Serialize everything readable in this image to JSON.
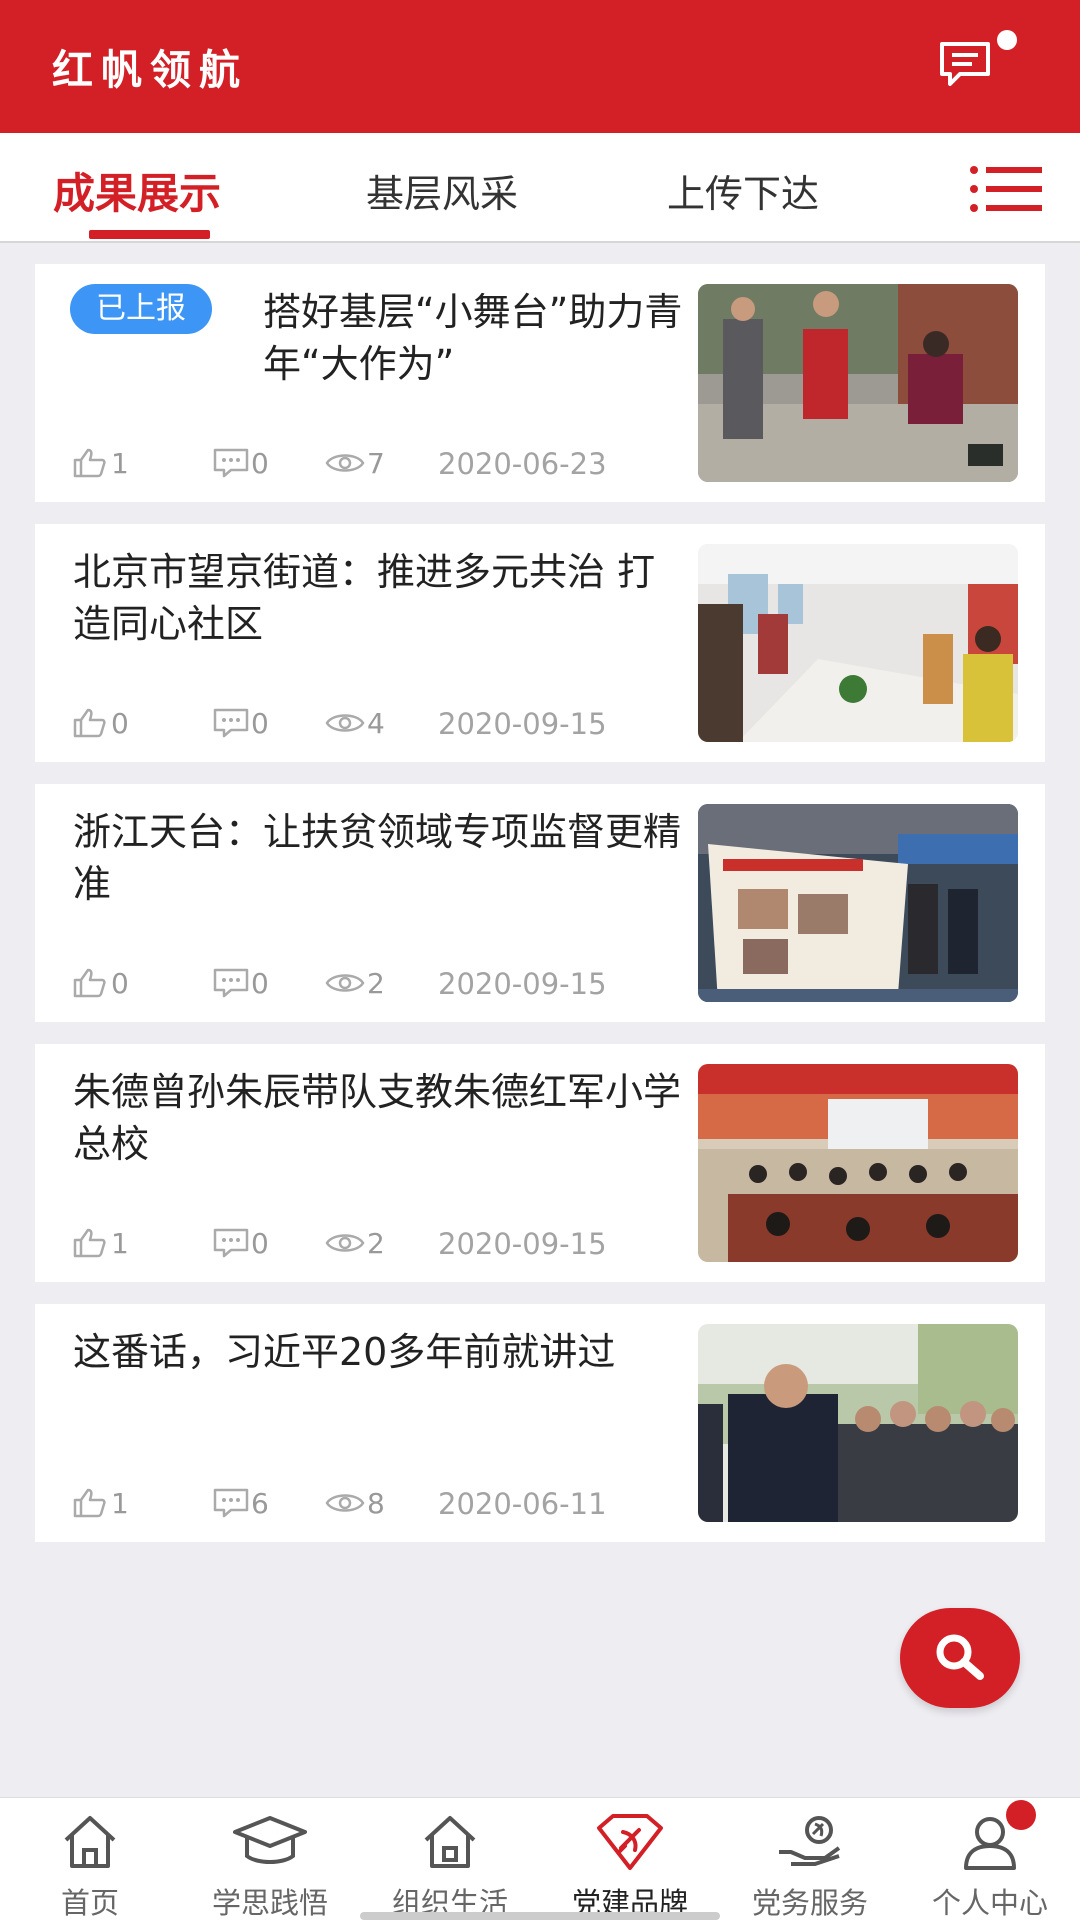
{
  "header": {
    "title": "红帆领航",
    "message_icon": "message-icon",
    "has_unread": true
  },
  "tabs": [
    {
      "label": "成果展示",
      "active": true
    },
    {
      "label": "基层风采",
      "active": false
    },
    {
      "label": "上传下达",
      "active": false
    }
  ],
  "articles": [
    {
      "badge": "已上报",
      "title": "搭好基层“小舞台”助力青年“大作为”",
      "likes": "1",
      "comments": "0",
      "views": "7",
      "date": "2020-06-23"
    },
    {
      "title": "北京市望京街道：推进多元共治 打造同心社区",
      "likes": "0",
      "comments": "0",
      "views": "4",
      "date": "2020-09-15"
    },
    {
      "title": "浙江天台：让扶贫领域专项监督更精准",
      "likes": "0",
      "comments": "0",
      "views": "2",
      "date": "2020-09-15"
    },
    {
      "title": "朱德曾孙朱辰带队支教朱德红军小学总校",
      "likes": "1",
      "comments": "0",
      "views": "2",
      "date": "2020-09-15"
    },
    {
      "title": "这番话，习近平20多年前就讲过",
      "likes": "1",
      "comments": "6",
      "views": "8",
      "date": "2020-06-11"
    }
  ],
  "bottom_nav": [
    {
      "label": "首页",
      "icon": "home-icon"
    },
    {
      "label": "学思践悟",
      "icon": "graduation-cap-icon"
    },
    {
      "label": "组织生活",
      "icon": "house-icon"
    },
    {
      "label": "党建品牌",
      "icon": "party-emblem-icon",
      "active": true
    },
    {
      "label": "党务服务",
      "icon": "hand-service-icon"
    },
    {
      "label": "个人中心",
      "icon": "person-icon",
      "has_badge": true
    }
  ],
  "colors": {
    "primary": "#d32027",
    "badge": "#3d96f5"
  }
}
